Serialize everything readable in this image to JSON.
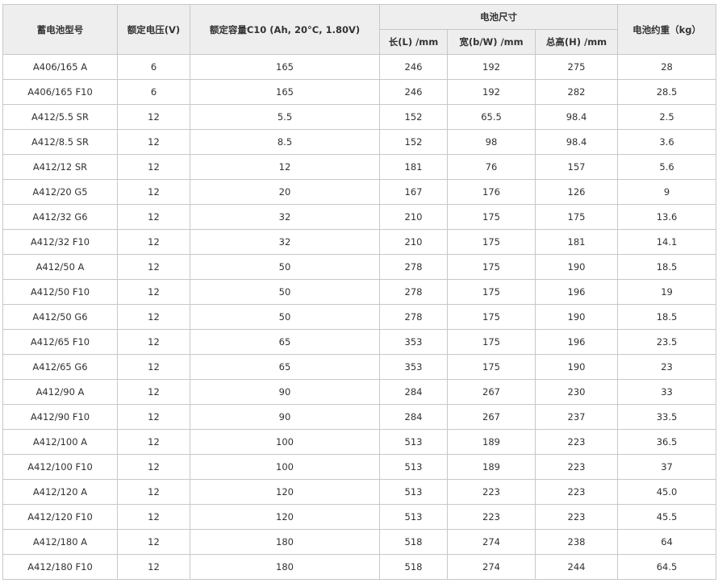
{
  "headers": {
    "model": "蓄电池型号",
    "voltage": "额定电压(V)",
    "capacity": "额定容量C10 (Ah, 20°C, 1.80V)",
    "dimensions": "电池尺寸",
    "length": "长(L) /mm",
    "width": "宽(b/W) /mm",
    "height": "总高(H) /mm",
    "weight": "电池约重（kg）"
  },
  "rows": [
    {
      "model": "A406/165 A",
      "voltage": "6",
      "capacity": "165",
      "length": "246",
      "width": "192",
      "height": "275",
      "weight": "28"
    },
    {
      "model": "A406/165 F10",
      "voltage": "6",
      "capacity": "165",
      "length": "246",
      "width": "192",
      "height": "282",
      "weight": "28.5"
    },
    {
      "model": "A412/5.5 SR",
      "voltage": "12",
      "capacity": "5.5",
      "length": "152",
      "width": "65.5",
      "height": "98.4",
      "weight": "2.5"
    },
    {
      "model": "A412/8.5 SR",
      "voltage": "12",
      "capacity": "8.5",
      "length": "152",
      "width": "98",
      "height": "98.4",
      "weight": "3.6"
    },
    {
      "model": "A412/12 SR",
      "voltage": "12",
      "capacity": "12",
      "length": "181",
      "width": "76",
      "height": "157",
      "weight": "5.6"
    },
    {
      "model": "A412/20 G5",
      "voltage": "12",
      "capacity": "20",
      "length": "167",
      "width": "176",
      "height": "126",
      "weight": "9"
    },
    {
      "model": "A412/32 G6",
      "voltage": "12",
      "capacity": "32",
      "length": "210",
      "width": "175",
      "height": "175",
      "weight": "13.6"
    },
    {
      "model": "A412/32 F10",
      "voltage": "12",
      "capacity": "32",
      "length": "210",
      "width": "175",
      "height": "181",
      "weight": "14.1"
    },
    {
      "model": "A412/50 A",
      "voltage": "12",
      "capacity": "50",
      "length": "278",
      "width": "175",
      "height": "190",
      "weight": "18.5"
    },
    {
      "model": "A412/50 F10",
      "voltage": "12",
      "capacity": "50",
      "length": "278",
      "width": "175",
      "height": "196",
      "weight": "19"
    },
    {
      "model": "A412/50 G6",
      "voltage": "12",
      "capacity": "50",
      "length": "278",
      "width": "175",
      "height": "190",
      "weight": "18.5"
    },
    {
      "model": "A412/65 F10",
      "voltage": "12",
      "capacity": "65",
      "length": "353",
      "width": "175",
      "height": "196",
      "weight": "23.5"
    },
    {
      "model": "A412/65 G6",
      "voltage": "12",
      "capacity": "65",
      "length": "353",
      "width": "175",
      "height": "190",
      "weight": "23"
    },
    {
      "model": "A412/90 A",
      "voltage": "12",
      "capacity": "90",
      "length": "284",
      "width": "267",
      "height": "230",
      "weight": "33"
    },
    {
      "model": "A412/90 F10",
      "voltage": "12",
      "capacity": "90",
      "length": "284",
      "width": "267",
      "height": "237",
      "weight": "33.5"
    },
    {
      "model": "A412/100 A",
      "voltage": "12",
      "capacity": "100",
      "length": "513",
      "width": "189",
      "height": "223",
      "weight": "36.5"
    },
    {
      "model": "A412/100 F10",
      "voltage": "12",
      "capacity": "100",
      "length": "513",
      "width": "189",
      "height": "223",
      "weight": "37"
    },
    {
      "model": "A412/120 A",
      "voltage": "12",
      "capacity": "120",
      "length": "513",
      "width": "223",
      "height": "223",
      "weight": "45.0"
    },
    {
      "model": "A412/120 F10",
      "voltage": "12",
      "capacity": "120",
      "length": "513",
      "width": "223",
      "height": "223",
      "weight": "45.5"
    },
    {
      "model": "A412/180 A",
      "voltage": "12",
      "capacity": "180",
      "length": "518",
      "width": "274",
      "height": "238",
      "weight": "64"
    },
    {
      "model": "A412/180 F10",
      "voltage": "12",
      "capacity": "180",
      "length": "518",
      "width": "274",
      "height": "244",
      "weight": "64.5"
    }
  ],
  "colors": {
    "header_bg": "#eeeeee",
    "border": "#c8c8c8",
    "text": "#333333"
  }
}
